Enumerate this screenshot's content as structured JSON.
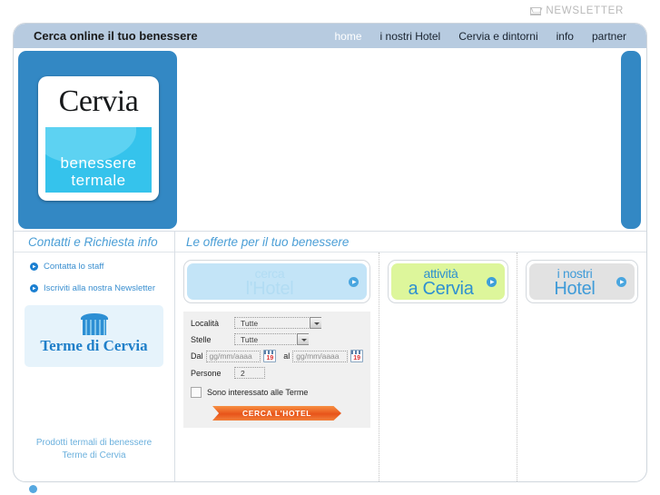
{
  "topbar": {
    "newsletter_label": "NEWSLETTER",
    "envelope_icon": "envelope-icon"
  },
  "header": {
    "site_title": "Cerca online il tuo benessere",
    "nav": [
      {
        "label": "home",
        "active": true
      },
      {
        "label": "i nostri Hotel",
        "active": false
      },
      {
        "label": "Cervia e dintorni",
        "active": false
      },
      {
        "label": "info",
        "active": false
      },
      {
        "label": "partner",
        "active": false
      }
    ]
  },
  "logo": {
    "word": "Cervia",
    "sub1": "benessere",
    "sub2": "termale"
  },
  "sidebar": {
    "title": "Contatti e Richiesta info",
    "links": [
      {
        "label": "Contatta lo staff",
        "icon": "arrow-circle-icon"
      },
      {
        "label": "Iscriviti alla nostra Newsletter",
        "icon": "arrow-circle-icon"
      }
    ],
    "banner": {
      "label": "Terme di Cervia",
      "icon": "fountain-icon"
    },
    "footer_line1": "Prodotti termali di benessere",
    "footer_line2": "Terme di Cervia"
  },
  "main": {
    "title": "Le offerte per il tuo benessere",
    "tabs": [
      {
        "line1": "cerca",
        "line2": "l'Hotel",
        "style": "blue",
        "go_icon": "arrow-circle-icon"
      },
      {
        "line1": "attività",
        "line2": "a Cervia",
        "style": "green",
        "go_icon": "arrow-circle-icon"
      },
      {
        "line1": "i nostri",
        "line2": "Hotel",
        "style": "gray",
        "go_icon": "arrow-circle-icon"
      }
    ],
    "form": {
      "localita_label": "Località",
      "localita_value": "Tutte",
      "stelle_label": "Stelle",
      "stelle_value": "Tutte",
      "dal_label": "Dal",
      "dal_placeholder": "gg/mm/aaaa",
      "al_label": "al",
      "al_placeholder": "gg/mm/aaaa",
      "calendar_day": "19",
      "persone_label": "Persone",
      "persone_value": "2",
      "terme_checkbox_label": "Sono interessato alle Terme",
      "terme_checked": false,
      "submit_label": "CERCA L'HOTEL"
    }
  },
  "colors": {
    "nav_bar": "#b7cbe0",
    "accent_blue": "#3388c4",
    "tab_blue": "#c3e4f7",
    "tab_green": "#ddf69b",
    "tab_gray": "#e2e2e2",
    "cta_orange": "#e8541a",
    "link_blue": "#3a8fd0"
  }
}
